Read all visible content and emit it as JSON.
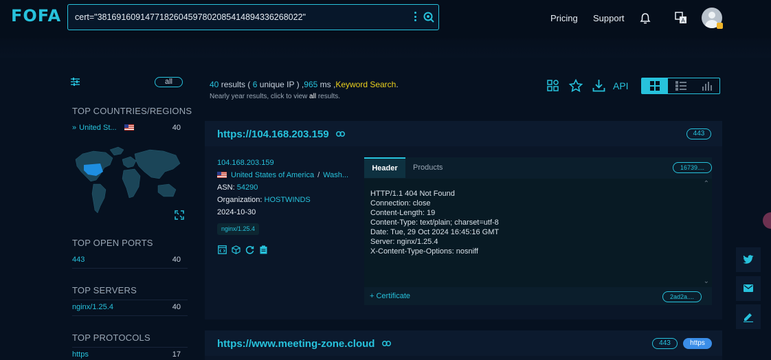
{
  "app": {
    "logo": "FOFA"
  },
  "search": {
    "query": "cert=\"3816916091477182604597802085414894336268022\""
  },
  "nav": {
    "pricing": "Pricing",
    "support": "Support"
  },
  "sidebar": {
    "filter_all": "all",
    "countries": {
      "title": "TOP COUNTRIES/REGIONS",
      "items": [
        {
          "label": "United St...",
          "count": "40"
        }
      ]
    },
    "ports": {
      "title": "TOP OPEN PORTS",
      "items": [
        {
          "label": "443",
          "count": "40"
        }
      ]
    },
    "servers": {
      "title": "TOP SERVERS",
      "items": [
        {
          "label": "nginx/1.25.4",
          "count": "40"
        }
      ]
    },
    "protocols": {
      "title": "TOP PROTOCOLS",
      "items": [
        {
          "label": "https",
          "count": "17"
        }
      ]
    }
  },
  "results": {
    "count": "40",
    "results_word": "results (",
    "unique_ip": "6",
    "unique_ip_label": "unique IP ) ,",
    "ms": "965",
    "ms_label": "ms ,",
    "keyword_search": "Keyword Search",
    "period": ".",
    "subtitle_pre": "Nearly year results, click to view",
    "subtitle_all": "all",
    "subtitle_post": "results.",
    "api_label": "API"
  },
  "cards": [
    {
      "title": "https://104.168.203.159",
      "port": "443",
      "ip": "104.168.203.159",
      "country": "United States of America",
      "sep": "/",
      "city": "Wash...",
      "asn_label": "ASN:",
      "asn": "54290",
      "org_label": "Organization:",
      "org": "HOSTWINDS",
      "date": "2024-10-30",
      "server_tag": "nginx/1.25.4",
      "tab_header": "Header",
      "tab_products": "Products",
      "hash": "16739....",
      "header_lines": [
        "HTTP/1.1 404 Not Found",
        "Connection: close",
        "Content-Length: 19",
        "Content-Type: text/plain; charset=utf-8",
        "Date: Tue, 29 Oct 2024 16:45:16 GMT",
        "Server: nginx/1.25.4",
        "X-Content-Type-Options: nosniff"
      ],
      "certificate_label": "+ Certificate",
      "cert_hash": "2ad2a...."
    },
    {
      "title": "https://www.meeting-zone.cloud",
      "port": "443",
      "protocol": "https"
    }
  ],
  "colors": {
    "accent": "#27c2dc",
    "keyword": "#ecd11d",
    "protocol_pill": "#3b8ee8"
  },
  "icons": [
    "filter-icon",
    "bell-icon",
    "translate-icon",
    "share-icon",
    "star-icon",
    "download-icon",
    "grid-view-icon",
    "list-view-icon",
    "chart-view-icon",
    "link-icon",
    "code-icon",
    "cube-icon",
    "refresh-icon",
    "clipboard-icon",
    "twitter-icon",
    "mail-icon",
    "edit-icon",
    "expand-icon"
  ]
}
